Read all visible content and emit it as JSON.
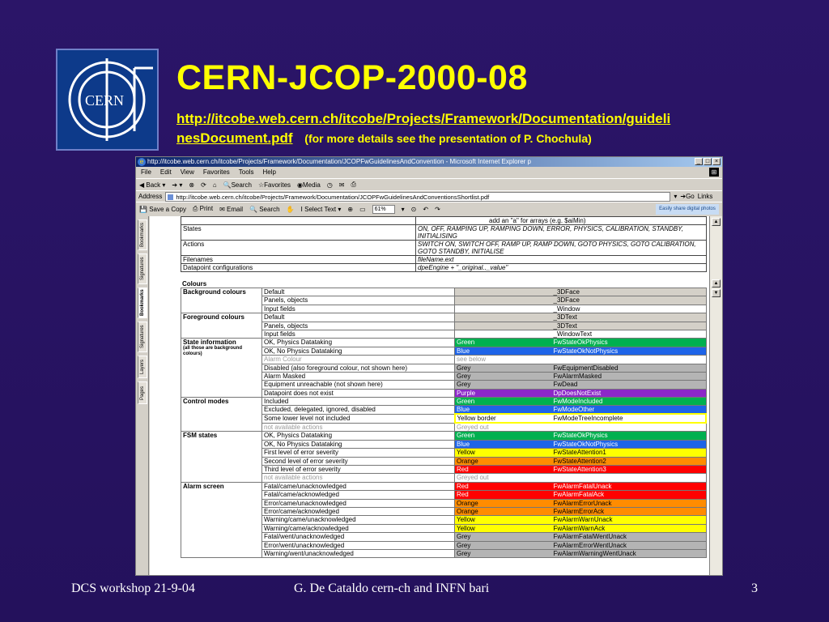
{
  "slide": {
    "title": "CERN-JCOP-2000-08",
    "url_line1": "http://itcobe.web.cern.ch/itcobe/Projects/Framework/Documentation/guideli",
    "url_line2": "nesDocument.pdf",
    "note": "(for more details see the presentation of P. Chochula)",
    "logo_text": "CERN"
  },
  "footer": {
    "left": "DCS workshop 21-9-04",
    "center": "G. De Cataldo cern-ch and INFN bari",
    "page": "3"
  },
  "browser": {
    "title": "http://itcobe.web.cern.ch/itcobe/Projects/Framework/Documentation/JCOPFwGuidelinesAndConvention - Microsoft Internet Explorer p",
    "menu": [
      "File",
      "Edit",
      "View",
      "Favorites",
      "Tools",
      "Help"
    ],
    "toolbar": {
      "back": "Back",
      "search": "Search",
      "favorites": "Favorites",
      "media": "Media"
    },
    "address_label": "Address",
    "address": "http://itcobe.web.cern.ch/itcobe/Projects/Framework/Documentation/JCOPFwGuidelinesAndConventionsShortlist.pdf",
    "go": "Go",
    "links": "Links",
    "acrobat": {
      "save": "Save a Copy",
      "print": "Print",
      "email": "Email",
      "search": "Search",
      "select": "Select Text",
      "zoom": "61%",
      "banner": "Easily share digital photos"
    },
    "sidebar_tabs": [
      "Bookmarks",
      "Signatures",
      "Bookmarks",
      "Signatures",
      "Layers",
      "Pages"
    ]
  },
  "doc": {
    "top_rows": [
      {
        "name": "",
        "value": "add an \"a\" for arrays (e.g. $aiMin)"
      },
      {
        "name": "States",
        "value": "ON, OFF, RAMPING UP, RAMPING DOWN, ERROR, PHYSICS, CALIBRATION, STANDBY, INITIALISING"
      },
      {
        "name": "Actions",
        "value": "SWITCH ON, SWITCH OFF, RAMP UP, RAMP DOWN, GOTO PHYSICS, GOTO CALIBRATION, GOTO STANDBY, INITIALISE"
      },
      {
        "name": "Filenames",
        "value": "fileName.ext"
      },
      {
        "name": "Datapoint configurations",
        "value": "dpeEngine + \"_original.._value\""
      }
    ],
    "colours_heading": "Colours",
    "groups": [
      {
        "label": "Background colours",
        "sub": "",
        "rows": [
          {
            "item": "Default",
            "colour": "",
            "name": "_3DFace",
            "bg": "#d4d0c8",
            "fg": "#000000"
          },
          {
            "item": "Panels, objects",
            "colour": "",
            "name": "_3DFace",
            "bg": "#d4d0c8",
            "fg": "#000000"
          },
          {
            "item": "Input fields",
            "colour": "",
            "name": "_Window",
            "bg": "#ffffff",
            "fg": "#000000"
          }
        ]
      },
      {
        "label": "Foreground colours",
        "sub": "",
        "rows": [
          {
            "item": "Default",
            "colour": "",
            "name": "_3DText",
            "bg": "#d4d0c8",
            "fg": "#000000"
          },
          {
            "item": "Panels, objects",
            "colour": "",
            "name": "_3DText",
            "bg": "#d4d0c8",
            "fg": "#000000"
          },
          {
            "item": "Input fields",
            "colour": "",
            "name": "_WindowText",
            "bg": "#ffffff",
            "fg": "#000000"
          }
        ]
      },
      {
        "label": "State information",
        "sub": "(all those are background colours)",
        "rows": [
          {
            "item": "OK, Physics Datataking",
            "colour": "Green",
            "name": "FwStateOkPhysics",
            "bg": "#00b050",
            "fg": "#ffffff"
          },
          {
            "item": "OK, No Physics Datataking",
            "colour": "Blue",
            "name": "FwStateOkNotPhysics",
            "bg": "#1e64e8",
            "fg": "#ffffff"
          },
          {
            "item": "Alarm Colour",
            "colour": "see below",
            "name": "",
            "bg": "#ffffff",
            "fg": "#9a9a9a"
          },
          {
            "item": "Disabled (also foreground colour, not shown here)",
            "colour": "Grey",
            "name": "FwEquipmentDisabled",
            "bg": "#b4b4b4",
            "fg": "#000000"
          },
          {
            "item": "Alarm Masked",
            "colour": "Grey",
            "name": "FwAlarmMasked",
            "bg": "#b4b4b4",
            "fg": "#000000"
          },
          {
            "item": "Equipment unreachable (not shown here)",
            "colour": "Grey",
            "name": "FwDead",
            "bg": "#b4b4b4",
            "fg": "#000000"
          },
          {
            "item": "Datapoint does not exist",
            "colour": "Purple",
            "name": "DpDoesNotExist",
            "bg": "#8c28c8",
            "fg": "#ffffff"
          }
        ]
      },
      {
        "label": "Control modes",
        "sub": "",
        "rows": [
          {
            "item": "Included",
            "colour": "Green",
            "name": "FwModeIncluded",
            "bg": "#00b050",
            "fg": "#ffffff"
          },
          {
            "item": "Excluded, delegated, ignored, disabled",
            "colour": "Blue",
            "name": "FwModeOther",
            "bg": "#1e64e8",
            "fg": "#ffffff"
          },
          {
            "item": "Some lower level not included",
            "colour": "Yellow border",
            "name": "FwModeTreeIncomplete",
            "bg": "#ffffff",
            "fg": "#000000",
            "border": "#ffff00"
          },
          {
            "item": "not available actions",
            "colour": "Greyed out",
            "name": "",
            "bg": "#ffffff",
            "fg": "#9a9a9a"
          }
        ]
      },
      {
        "label": "FSM states",
        "sub": "",
        "rows": [
          {
            "item": "OK, Physics Datataking",
            "colour": "Green",
            "name": "FwStateOkPhysics",
            "bg": "#00b050",
            "fg": "#ffffff"
          },
          {
            "item": "OK, No Physics Datataking",
            "colour": "Blue",
            "name": "FwStateOkNotPhysics",
            "bg": "#1e64e8",
            "fg": "#ffffff"
          },
          {
            "item": "First level of error severity",
            "colour": "Yellow",
            "name": "FwStateAttention1",
            "bg": "#ffff00",
            "fg": "#000000"
          },
          {
            "item": "Second level of error severity",
            "colour": "Orange",
            "name": "FwStateAttention2",
            "bg": "#ff8c00",
            "fg": "#000000"
          },
          {
            "item": "Third level of error severity",
            "colour": "Red",
            "name": "FwStateAttention3",
            "bg": "#ff0000",
            "fg": "#ffffff"
          },
          {
            "item": "not available actions",
            "colour": "Greyed out",
            "name": "",
            "bg": "#ffffff",
            "fg": "#9a9a9a"
          }
        ]
      },
      {
        "label": "Alarm screen",
        "sub": "",
        "rows": [
          {
            "item": "Fatal/came/unacknowledged",
            "colour": "Red",
            "name": "FwAlarmFatalUnack",
            "bg": "#ff0000",
            "fg": "#ffffff"
          },
          {
            "item": "Fatal/came/acknowledged",
            "colour": "Red",
            "name": "FwAlarmFatalAck",
            "bg": "#ff0000",
            "fg": "#ffffff"
          },
          {
            "item": "Error/came/unacknowledged",
            "colour": "Orange",
            "name": "FwAlarmErrorUnack",
            "bg": "#ff8c00",
            "fg": "#000000"
          },
          {
            "item": "Error/came/acknowledged",
            "colour": "Orange",
            "name": "FwAlarmErrorAck",
            "bg": "#ff8c00",
            "fg": "#000000"
          },
          {
            "item": "Warning/came/unacknowledged",
            "colour": "Yellow",
            "name": "FwAlarmWarnUnack",
            "bg": "#ffff00",
            "fg": "#000000"
          },
          {
            "item": "Warning/came/acknowledged",
            "colour": "Yellow",
            "name": "FwAlarmWarnAck",
            "bg": "#ffff00",
            "fg": "#000000"
          },
          {
            "item": "Fatal/went/unacknowledged",
            "colour": "Grey",
            "name": "FwAlarmFatalWentUnack",
            "bg": "#b4b4b4",
            "fg": "#000000"
          },
          {
            "item": "Error/went/unacknowledged",
            "colour": "Grey",
            "name": "FwAlarmErrorWentUnack",
            "bg": "#b4b4b4",
            "fg": "#000000"
          },
          {
            "item": "Warning/went/unacknowledged",
            "colour": "Grey",
            "name": "FwAlarmWarningWentUnack",
            "bg": "#b4b4b4",
            "fg": "#000000"
          }
        ]
      }
    ]
  }
}
